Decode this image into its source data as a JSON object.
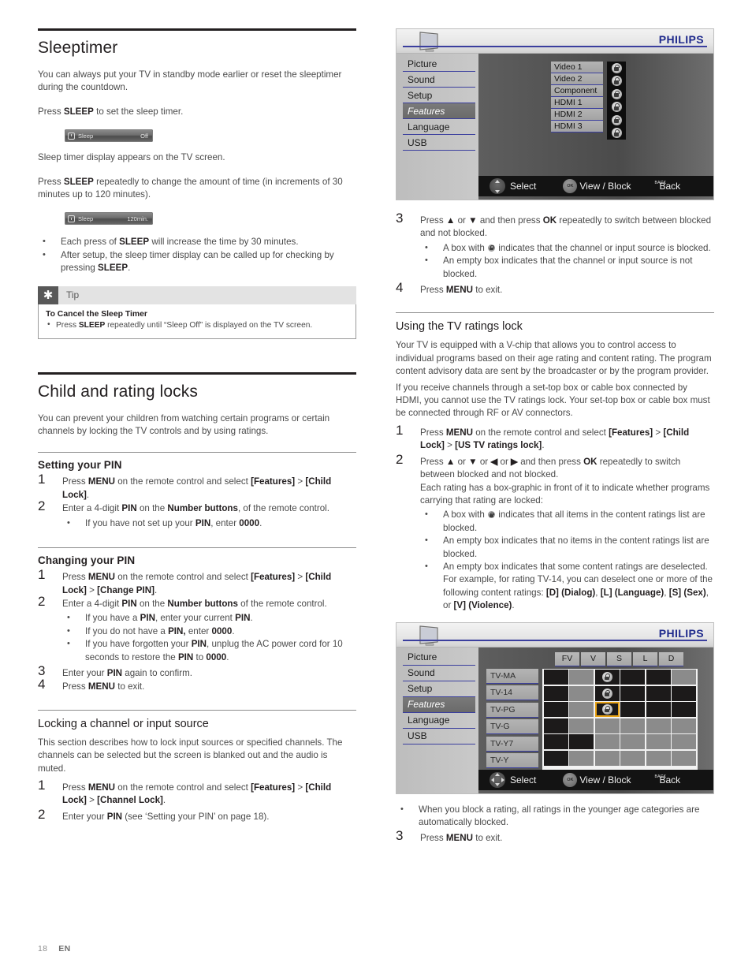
{
  "footer": {
    "page": "18",
    "lang": "EN"
  },
  "left": {
    "sleeptimer": {
      "title": "Sleeptimer",
      "p1": "You can always put your TV in standby mode earlier or reset the sleeptimer during the countdown.",
      "p2_pre": "Press ",
      "p2_b": "SLEEP",
      "p2_post": " to set the sleep timer.",
      "bar1": {
        "icon": "alarm-clock-icon",
        "label": "Sleep",
        "value": "Off"
      },
      "p3": "Sleep timer display appears on the TV screen.",
      "p4_pre": "Press ",
      "p4_b": "SLEEP",
      "p4_post": " repeatedly to change the amount of time (in increments of 30 minutes up to 120 minutes).",
      "bar2": {
        "icon": "alarm-clock-icon",
        "label": "Sleep",
        "value": "120min."
      },
      "bullets": [
        {
          "pre": "Each press of ",
          "b": "SLEEP",
          "post": " will increase the time by 30 minutes."
        },
        {
          "pre": "After setup, the sleep timer display can be called up for checking by pressing ",
          "b": "SLEEP",
          "post": "."
        }
      ],
      "tip": {
        "label": "Tip",
        "title": "To Cancel the Sleep Timer",
        "line_pre": "Press ",
        "line_b": "SLEEP",
        "line_post": " repeatedly until “Sleep Off” is displayed on the TV screen."
      }
    },
    "childlocks": {
      "title": "Child and rating locks",
      "intro": "You can prevent your children from watching certain programs or certain channels by locking the TV controls and by using ratings.",
      "setting_pin": {
        "heading": "Setting your PIN",
        "steps": [
          {
            "num": "1",
            "parts": [
              "Press ",
              "MENU",
              " on the remote control and select ",
              "[Features]",
              " > ",
              "[Child Lock]",
              "."
            ]
          },
          {
            "num": "2",
            "parts": [
              "Enter a 4-digit ",
              "PIN",
              " on the ",
              "Number buttons",
              ", of the remote control."
            ]
          }
        ],
        "bullet": {
          "pre": "If you have not set up your ",
          "b1": "PIN",
          "mid": ", enter ",
          "b2": "0000",
          "post": "."
        }
      },
      "changing_pin": {
        "heading": "Changing your PIN",
        "steps": [
          {
            "num": "1",
            "parts": [
              "Press ",
              "MENU",
              " on the remote control and select ",
              "[Features]",
              " > ",
              "[Child Lock]",
              " > ",
              "[Change PIN]",
              "."
            ]
          },
          {
            "num": "2",
            "parts": [
              "Enter a 4-digit ",
              "PIN",
              " on the ",
              "Number buttons",
              " of the remote control."
            ]
          },
          {
            "num": "3",
            "parts": [
              "Enter your ",
              "PIN",
              " again to confirm."
            ]
          },
          {
            "num": "4",
            "parts": [
              "Press ",
              "MENU",
              " to exit."
            ]
          }
        ],
        "bullets": [
          {
            "pre": "If you have a ",
            "b1": "PIN",
            "mid": ", enter your current ",
            "b2": "PIN",
            "post": "."
          },
          {
            "pre": "If you do not have a ",
            "b1": "PIN,",
            "mid": " enter ",
            "b2": "0000",
            "post": "."
          },
          {
            "pre": "If you have forgotten your ",
            "b1": "PIN",
            "mid": ", unplug the AC power cord for 10 seconds to restore the ",
            "b2": "PIN",
            "post": " to ",
            "b3": "0000",
            "post2": "."
          }
        ]
      },
      "locking_channel": {
        "heading": "Locking a channel or input source",
        "intro": "This section describes how to lock input sources or specified channels. The channels can be selected but the screen is blanked out and the audio is muted.",
        "steps": [
          {
            "num": "1",
            "parts": [
              "Press ",
              "MENU",
              " on the remote control and select ",
              "[Features]",
              " > ",
              "[Child Lock]",
              " > ",
              "[Channel Lock]",
              "."
            ]
          },
          {
            "num": "2",
            "parts": [
              "Enter your ",
              "PIN",
              " (see ‘Setting your PIN’ on page 18)."
            ]
          }
        ]
      }
    }
  },
  "right": {
    "osd_sources": {
      "brand": "PHILIPS",
      "menu": [
        "Picture",
        "Sound",
        "Setup",
        "Features",
        "Language",
        "USB"
      ],
      "selected_menu": "Features",
      "sources": [
        "Video 1",
        "Video 2",
        "Component",
        "HDMI 1",
        "HDMI 2",
        "HDMI 3"
      ],
      "locks": [
        true,
        true,
        true,
        true,
        true,
        true
      ],
      "bottom_bar": [
        {
          "icon": "dpad-updown-icon",
          "label": "Select"
        },
        {
          "icon": "ok-button-icon",
          "label": "View / Block"
        },
        {
          "icon": "back-button-icon",
          "cap": "BACK",
          "label": "Back"
        }
      ]
    },
    "step3": {
      "num": "3",
      "parts": [
        "Press ",
        "▲",
        " or ",
        "▼",
        " and then press ",
        "OK",
        " repeatedly to switch between blocked and not blocked."
      ],
      "bullets": [
        {
          "pre": "A box with ",
          "icon": "lock-icon",
          "post": " indicates that the channel or input source is blocked."
        },
        {
          "pre": "An empty box indicates that the channel or input source is not blocked.",
          "icon": "",
          "post": ""
        }
      ]
    },
    "step4": {
      "num": "4",
      "parts": [
        "Press ",
        "MENU",
        " to exit."
      ]
    },
    "tvratings": {
      "title": "Using the TV ratings lock",
      "p1": "Your TV is equipped with a V-chip that allows you to control access to individual programs based on their age rating and content rating. The program content advisory data are sent by the broadcaster or by the program provider.",
      "p2": "If you receive channels through a set-top box or cable box connected by HDMI, you cannot use the TV ratings lock. Your set-top box or cable box must be connected through RF or AV connectors.",
      "step1": {
        "num": "1",
        "parts": [
          "Press ",
          "MENU",
          " on the remote control and select ",
          "[Features]",
          " > ",
          "[Child Lock]",
          " > ",
          "[US TV ratings lock]",
          "."
        ]
      },
      "step2": {
        "num": "2",
        "line1": [
          "Press ",
          "▲",
          " or ",
          "▼",
          " or ",
          "◀",
          " or ",
          "▶",
          " and then press ",
          "OK",
          " repeatedly to switch between blocked and not blocked."
        ],
        "line2": "Each rating has a box-graphic in front of it to indicate whether programs carrying that rating are locked:",
        "bullets": [
          {
            "pre": "A box with ",
            "icon": "lock-icon",
            "post": " indicates that all items in the content ratings list are blocked."
          },
          {
            "pre": "An empty box indicates that no items in the content ratings list are blocked.",
            "icon": "",
            "post": ""
          },
          {
            "pre": "An empty box indicates that some content ratings are deselected. For example, for rating TV-14, you can deselect one or more of the following content ratings: ",
            "b1": "[D] (Dialog)",
            "mid1": ", ",
            "b2": "[L] (Language)",
            "mid2": ", ",
            "b3": "[S] (Sex)",
            "mid3": ", or ",
            "b4": "[V] (Violence)",
            "post": "."
          }
        ]
      },
      "final_bullet": "When you block a rating, all ratings in the younger age categories are automatically blocked.",
      "step3": {
        "num": "3",
        "parts": [
          "Press ",
          "MENU",
          " to exit."
        ]
      }
    },
    "osd_ratings": {
      "brand": "PHILIPS",
      "menu": [
        "Picture",
        "Sound",
        "Setup",
        "Features",
        "Language",
        "USB"
      ],
      "selected_menu": "Features",
      "columns": [
        "",
        "FV",
        "V",
        "S",
        "L",
        "D"
      ],
      "rows": [
        "TV-MA",
        "TV-14",
        "TV-PG",
        "TV-G",
        "TV-Y7",
        "TV-Y"
      ],
      "grid": [
        [
          "dark",
          "gray",
          "lock",
          "dark",
          "dark",
          "gray"
        ],
        [
          "dark",
          "gray",
          "lock",
          "dark",
          "dark",
          "dark"
        ],
        [
          "dark",
          "gray",
          "lock-cursor",
          "dark",
          "dark",
          "dark"
        ],
        [
          "dark",
          "gray",
          "gray",
          "gray",
          "gray",
          "gray"
        ],
        [
          "dark",
          "dark",
          "gray",
          "gray",
          "gray",
          "gray"
        ],
        [
          "dark",
          "gray",
          "gray",
          "gray",
          "gray",
          "gray"
        ]
      ],
      "cursor_color": "#e8a317",
      "bottom_bar": [
        {
          "icon": "dpad-all-icon",
          "label": "Select"
        },
        {
          "icon": "ok-button-icon",
          "label": "View / Block"
        },
        {
          "icon": "back-button-icon",
          "cap": "BACK",
          "label": "Back"
        }
      ]
    }
  }
}
